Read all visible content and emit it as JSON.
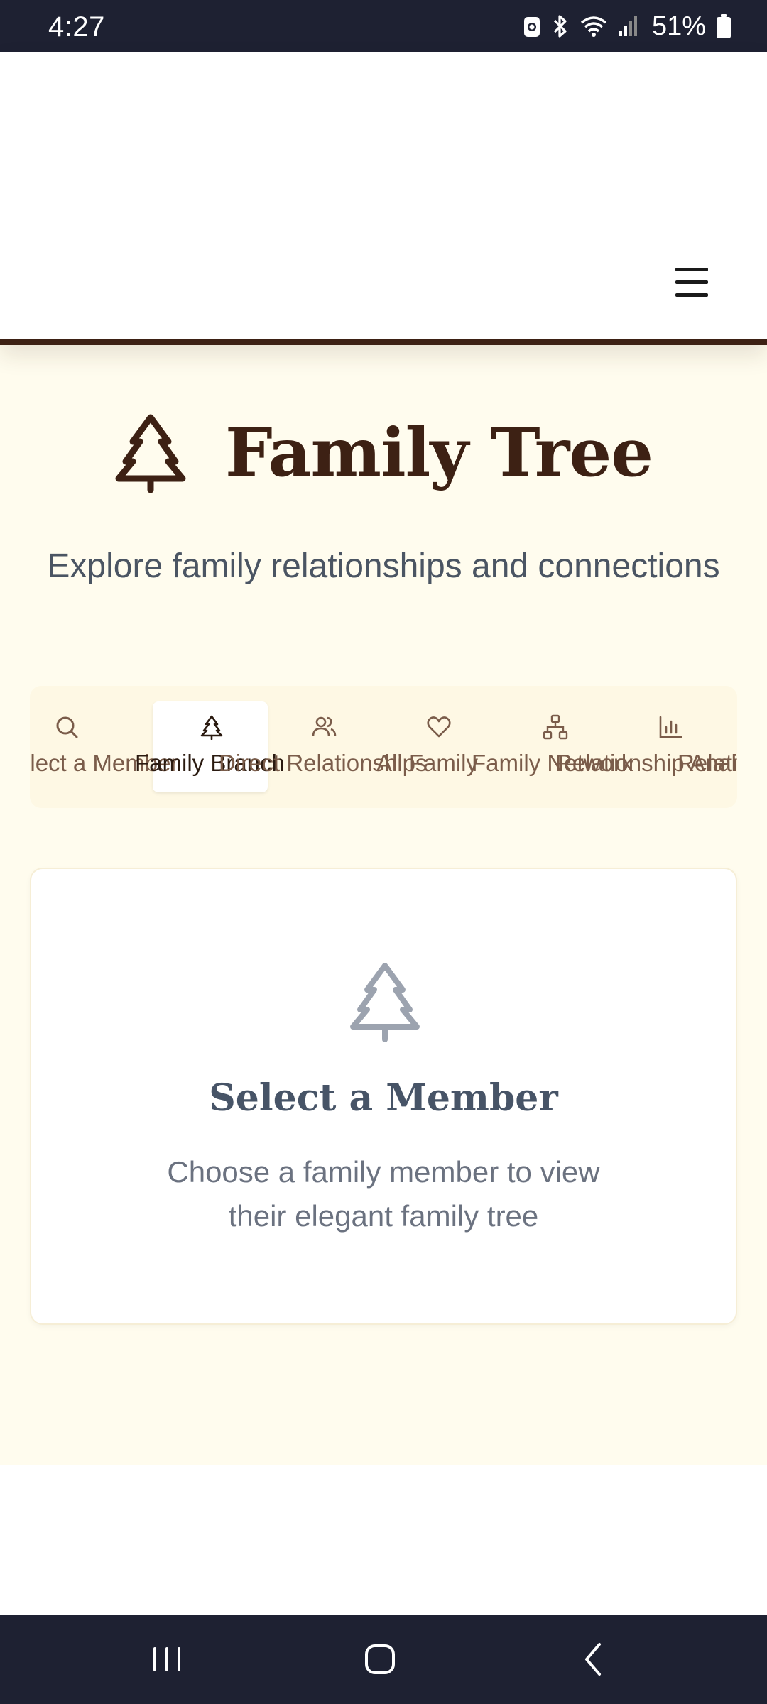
{
  "status_bar": {
    "time": "4:27",
    "battery_percent": "51%",
    "icons": [
      "alarm-icon",
      "bluetooth-icon",
      "wifi-icon",
      "signal-icon",
      "battery-icon"
    ]
  },
  "header": {
    "menu_icon": "hamburger-menu-icon"
  },
  "hero": {
    "title": "Family Tree",
    "subtitle": "Explore family relationships and connections",
    "icon": "pine-tree-icon"
  },
  "tabs": [
    {
      "label": "Select a Member",
      "icon": "search-icon",
      "active": false
    },
    {
      "label": "Family Branch",
      "icon": "tree-icon",
      "active": true
    },
    {
      "label": "Direct Relationships",
      "icon": "users-icon",
      "active": false
    },
    {
      "label": "All Family",
      "icon": "heart-icon",
      "active": false
    },
    {
      "label": "Family Network",
      "icon": "network-icon",
      "active": false
    },
    {
      "label": "Relationship Analysis",
      "icon": "bar-chart-icon",
      "active": false
    },
    {
      "label": "Relationship Counter",
      "icon": "bar-chart-icon",
      "active": false
    }
  ],
  "empty_state": {
    "title": "Select a Member",
    "description": "Choose a family member to view their elegant family tree",
    "icon": "pine-tree-icon"
  },
  "nav_bar": {
    "buttons": [
      "recent-apps-icon",
      "home-icon",
      "back-icon"
    ]
  },
  "colors": {
    "brand_brown": "#3d2114",
    "cream_background": "#fffcee",
    "system_bar": "#1e2132"
  }
}
